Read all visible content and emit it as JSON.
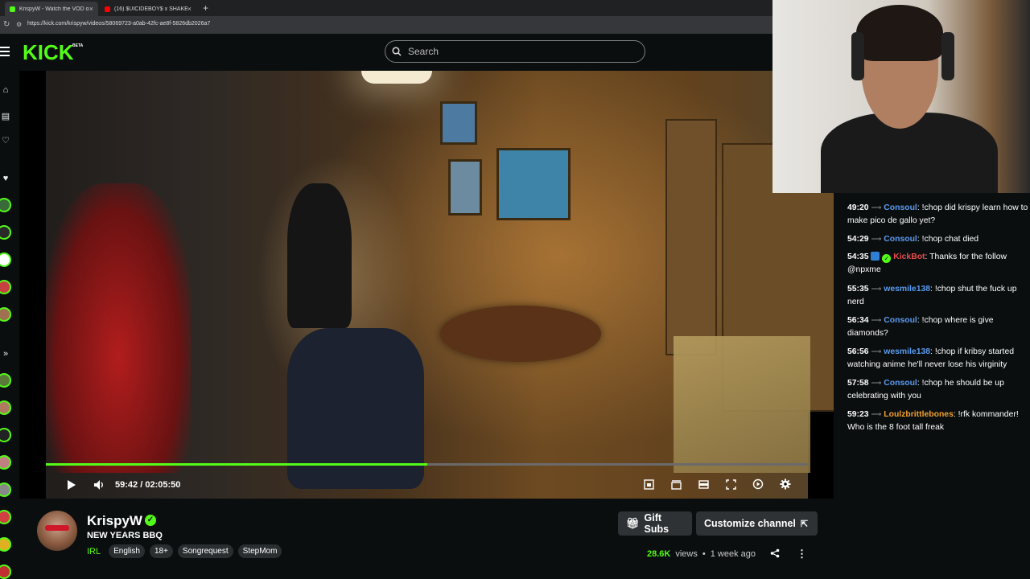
{
  "browser": {
    "tabs": [
      {
        "title": "KrispyW - Watch the VOD on Kick",
        "fav_color": "#53fc18",
        "active": true
      },
      {
        "title": "(16) $UICIDEBOY$ x SHAKEWELL",
        "fav_color": "#ff0000",
        "active": false
      }
    ],
    "url": "https://kick.com/krispyw/videos/58069723-a0ab-42fc-ae8f-5826db2026a7"
  },
  "header": {
    "logo": "KICK",
    "beta": "BETA",
    "search_placeholder": "Search"
  },
  "player": {
    "progress": 0.5,
    "current_time": "59:42",
    "separator": "/",
    "duration": "02:05:50"
  },
  "chat": {
    "messages": [
      {
        "ts": "49:20",
        "user": "Consoul",
        "color": "#5a9cf0",
        "text": "!chop did krispy learn how to make pico de gallo yet?",
        "badges": []
      },
      {
        "ts": "54:29",
        "user": "Consoul",
        "color": "#5a9cf0",
        "text": "!chop chat died",
        "badges": []
      },
      {
        "ts": "54:35",
        "user": "KickBot",
        "color": "#e84c4c",
        "text": "Thanks for the follow @npxme",
        "badges": [
          "blue",
          "green"
        ]
      },
      {
        "ts": "55:35",
        "user": "wesmile138",
        "color": "#5a9cf0",
        "text": "!chop shut the fuck up nerd",
        "badges": []
      },
      {
        "ts": "56:34",
        "user": "Consoul",
        "color": "#5a9cf0",
        "text": "!chop where is give diamonds?",
        "badges": []
      },
      {
        "ts": "56:56",
        "user": "wesmile138",
        "color": "#5a9cf0",
        "text": "!chop if kribsy started watching anime he'll never lose his virginity",
        "badges": []
      },
      {
        "ts": "57:58",
        "user": "Consoul",
        "color": "#5a9cf0",
        "text": "!chop he should be up celebrating with you",
        "badges": []
      },
      {
        "ts": "59:23",
        "user": "Loulzbrittlebones",
        "color": "#f0a030",
        "text": "!rfk kommander! Who is the 8 foot tall freak",
        "badges": []
      }
    ]
  },
  "channel": {
    "name": "KrispyW",
    "video_title": "NEW YEARS BBQ",
    "category": "IRL",
    "tags": [
      "English",
      "18+",
      "Songrequest",
      "StepMom"
    ],
    "gift_subs": "Gift Subs",
    "customize": "Customize channel",
    "views_count": "28.6K",
    "views_label": "views",
    "dot": "•",
    "age": "1 week ago"
  },
  "colors": {
    "brand": "#53fc18",
    "bg": "#0b0e0f"
  }
}
